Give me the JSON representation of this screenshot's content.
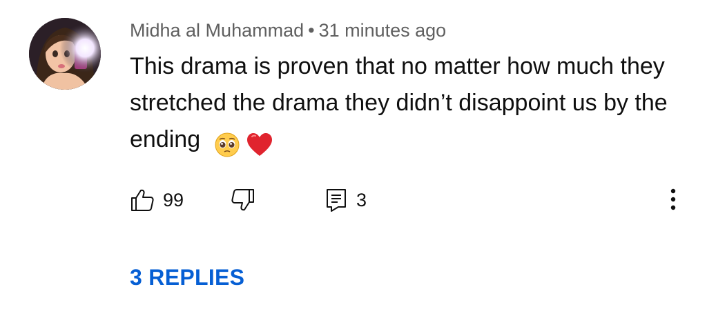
{
  "comment": {
    "author": "Midha al Muhammad",
    "separator": "•",
    "timestamp": "31 minutes ago",
    "text": "This drama is proven that no matter how much they stretched the drama they didn’t disappoint us by the ending",
    "emojis": [
      "pleading-face",
      "red-heart"
    ],
    "avatar_icon": "profile-avatar"
  },
  "actions": {
    "like_icon": "thumbs-up-icon",
    "like_count": "99",
    "dislike_icon": "thumbs-down-icon",
    "reply_icon": "comment-icon",
    "reply_count": "3",
    "more_icon": "more-vertical-icon"
  },
  "replies": {
    "label": "3 REPLIES"
  },
  "colors": {
    "meta_text": "#606060",
    "body_text": "#0f0f0f",
    "link_blue": "#065fd4"
  }
}
